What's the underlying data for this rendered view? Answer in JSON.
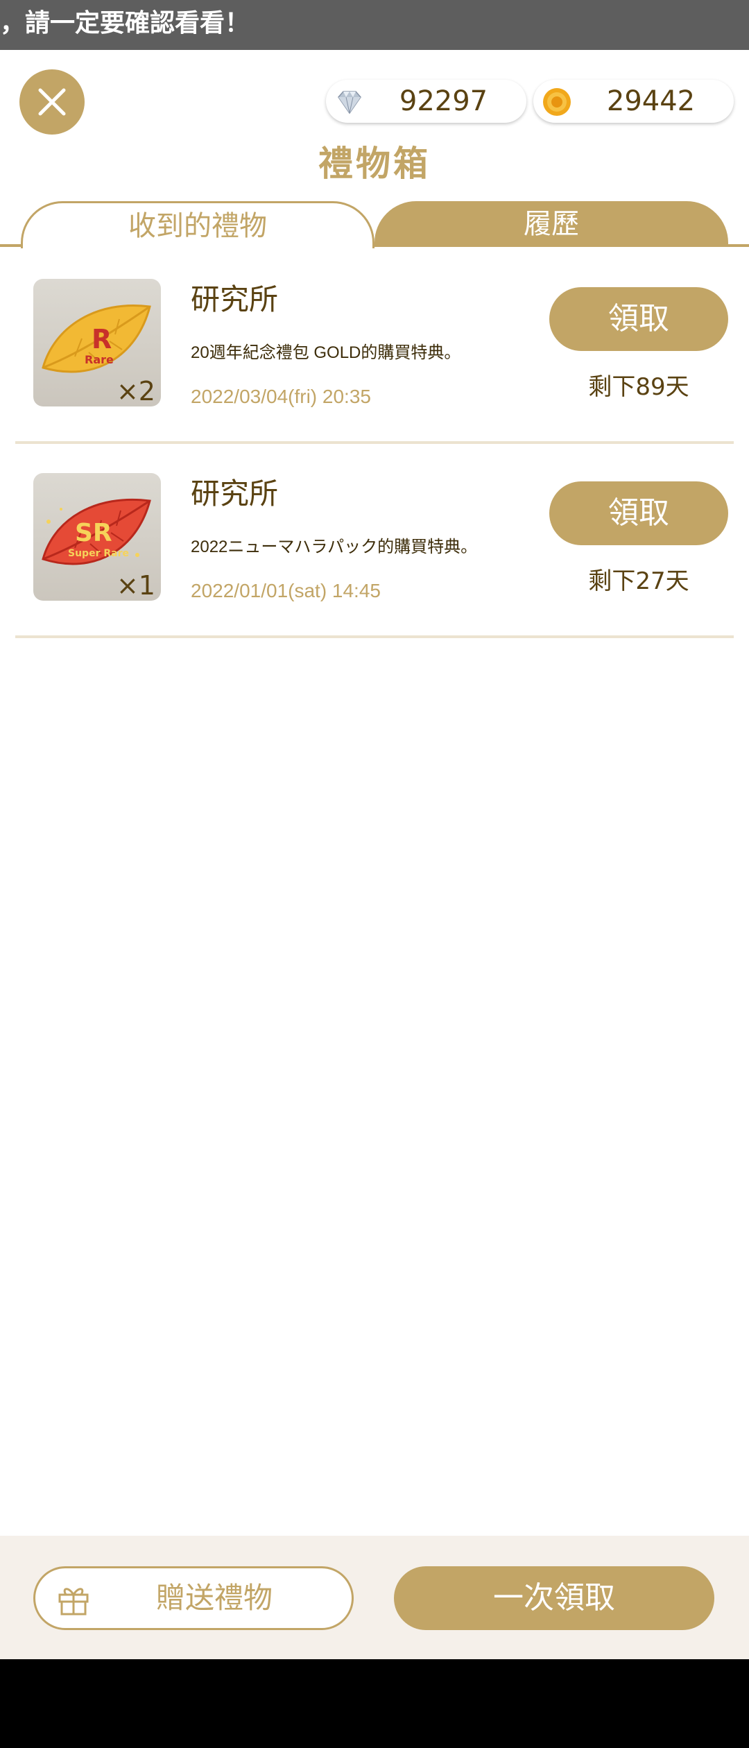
{
  "ticker": {
    "text": "，請一定要確認看看！"
  },
  "header": {
    "gems": "92297",
    "coins": "29442",
    "title": "禮物箱"
  },
  "tabs": [
    {
      "label": "收到的禮物",
      "active": true
    },
    {
      "label": "履歷",
      "active": false
    }
  ],
  "gifts": [
    {
      "qty": "×2",
      "badge": "R",
      "badge_sub": "Rare",
      "name": "研究所",
      "desc": "20週年紀念禮包 GOLD的購買特典。",
      "date": "2022/03/04(fri) 20:35",
      "claim_label": "領取",
      "remaining": "剩下89天"
    },
    {
      "qty": "×1",
      "badge": "SR",
      "badge_sub": "Super Rare",
      "name": "研究所",
      "desc": "2022ニューマハラパック的購買特典。",
      "date": "2022/01/01(sat) 14:45",
      "claim_label": "領取",
      "remaining": "剩下27天"
    }
  ],
  "footer": {
    "send_label": "贈送禮物",
    "claim_all_label": "一次領取"
  },
  "colors": {
    "accent": "#c2a566",
    "text_dark": "#5a4212",
    "footer_bg": "#f5f0ea"
  }
}
